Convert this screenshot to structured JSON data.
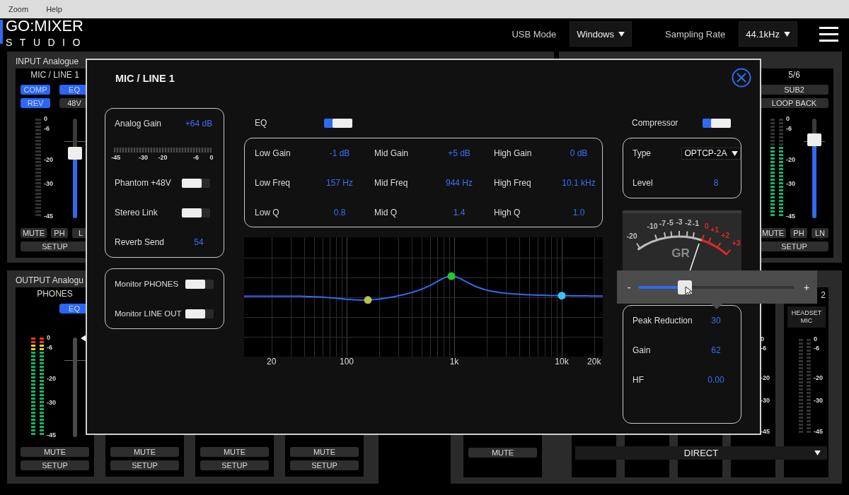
{
  "menu_bar": {
    "items": [
      "Zoom",
      "Help"
    ]
  },
  "header": {
    "logo": {
      "line_1": "GO:MIXER",
      "line_2": "STUDIO"
    },
    "usb_mode": {
      "label": "USB Mode",
      "value": "Windows"
    },
    "sampling_rate": {
      "label": "Sampling Rate",
      "value": "44.1kHz"
    }
  },
  "input_panel": {
    "title": "INPUT Analogue",
    "strips": [
      {
        "kind": "channel",
        "label": "MIC / LINE 1",
        "top_rows": [
          [
            {
              "text": "COMP",
              "on": true,
              "kind": "narrow"
            },
            {
              "text": "EQ",
              "on": true,
              "kind": "narrow"
            }
          ],
          [
            {
              "text": "REV",
              "on": true,
              "kind": "narrow"
            },
            {
              "text": "48V",
              "on": false,
              "kind": "narrow"
            }
          ]
        ],
        "meter": {
          "kind": "mono",
          "level": 0
        },
        "scale": [
          "0",
          "-6",
          "-20",
          "-30",
          "-45"
        ],
        "fader": {
          "kind": "input",
          "level": 0.65
        },
        "bottom_rows": [
          [
            {
              "text": "MUTE",
              "on": false,
              "kind": "wide"
            },
            {
              "text": "PH",
              "on": false,
              "kind": "narrow"
            },
            {
              "text": "L",
              "on": false,
              "kind": "narrow"
            }
          ],
          [
            {
              "text": "SETUP",
              "on": false,
              "kind": "wide"
            }
          ]
        ]
      }
    ]
  },
  "aux_panel": {
    "strips": [
      {
        "kind": "channel",
        "label": "5/6",
        "top_rows": [
          [
            {
              "text": "SUB2",
              "on": false,
              "kind": "wide"
            }
          ],
          [
            {
              "text": "LOOP BACK",
              "on": false,
              "kind": "wide"
            }
          ]
        ],
        "meter": {
          "kind": "stereo",
          "level": 0.71
        },
        "scale": [
          "0",
          "-6",
          "-20",
          "-30",
          "-45"
        ],
        "fader": {
          "kind": "input",
          "level": 0.79
        },
        "bottom_rows": [
          [
            {
              "text": "MUTE",
              "on": false,
              "kind": "wide"
            },
            {
              "text": "PH",
              "on": false,
              "kind": "narrow"
            },
            {
              "text": "LN",
              "on": false,
              "kind": "narrow"
            }
          ],
          [
            {
              "text": "SETUP",
              "on": false,
              "kind": "wide"
            }
          ]
        ]
      }
    ]
  },
  "output_panel": {
    "title": "OUTPUT Analogu",
    "strips": [
      {
        "kind": "channel",
        "label": "PHONES",
        "top_rows": [
          [
            {
              "text": "EQ",
              "on": true,
              "kind": "narrow"
            }
          ]
        ],
        "meter": {
          "kind": "stereo",
          "level": 1
        },
        "scale": [
          "0",
          "-6",
          "-20",
          "-30",
          "-45"
        ],
        "fader": {
          "kind": "output"
        },
        "bottom_rows": [
          [
            {
              "text": "MUTE",
              "on": false,
              "kind": "wide"
            }
          ],
          [
            {
              "text": "SETUP",
              "on": false,
              "kind": "wide"
            }
          ]
        ]
      },
      {
        "kind": "channel",
        "bottom_rows": [
          [
            {
              "text": "MUTE",
              "on": false,
              "kind": "wide"
            }
          ],
          [
            {
              "text": "SETUP",
              "on": false,
              "kind": "wide"
            }
          ]
        ]
      },
      {
        "kind": "channel",
        "bottom_rows": [
          [
            {
              "text": "MUTE",
              "on": false,
              "kind": "wide"
            }
          ],
          [
            {
              "text": "SETUP",
              "on": false,
              "kind": "wide"
            }
          ]
        ]
      },
      {
        "kind": "channel",
        "bottom_rows": [
          [
            {
              "text": "MUTE",
              "on": false,
              "kind": "wide"
            }
          ],
          [
            {
              "text": "SETUP",
              "on": false,
              "kind": "wide"
            }
          ]
        ]
      }
    ]
  },
  "return_panel": {
    "strips": [
      {
        "kind": "channel",
        "bottom_rows": [
          [
            {
              "text": "MUTE",
              "on": false,
              "kind": "wide"
            }
          ]
        ]
      },
      {
        "kind": "narrow"
      },
      {
        "kind": "narrow"
      },
      {
        "kind": "narrow"
      },
      {
        "kind": "narrow",
        "scale": [
          "0",
          "-6",
          "-20",
          "-30",
          "-45"
        ]
      },
      {
        "kind": "narrow",
        "label": "2",
        "header": "HEADSET MIC",
        "meter": {
          "kind": "stereo",
          "level": 0
        },
        "scale": [
          "0",
          "-6",
          "-20",
          "-30",
          "-45"
        ]
      }
    ],
    "route_select": "DIRECT"
  },
  "dialog": {
    "title": "MIC / LINE 1",
    "input_card": {
      "analog_gain": {
        "label": "Analog Gain",
        "value": "+64 dB"
      },
      "gain_meter": {
        "level": 0,
        "scale": [
          "-45",
          "-30",
          "-20",
          "-6",
          "0"
        ]
      },
      "toggles": [
        {
          "label": "Phantom +48V",
          "on": false
        },
        {
          "label": "Stereo Link",
          "on": false
        }
      ],
      "reverb_send": {
        "label": "Reverb Send",
        "value": "54"
      }
    },
    "monitor_card": {
      "toggles": [
        {
          "label": "Monitor PHONES",
          "on": false
        },
        {
          "label": "Monitor LINE OUT",
          "on": false
        }
      ]
    },
    "eq": {
      "label": "EQ",
      "on": true,
      "bands": [
        {
          "color": "#b8c44a",
          "params": [
            {
              "label": "Low Gain",
              "value": "-1 dB"
            },
            {
              "label": "Low Freq",
              "value": "157 Hz"
            },
            {
              "label": "Low Q",
              "value": "0.8"
            }
          ]
        },
        {
          "color": "#22c92a",
          "params": [
            {
              "label": "Mid Gain",
              "value": "+5 dB"
            },
            {
              "label": "Mid Freq",
              "value": "944 Hz"
            },
            {
              "label": "Mid Q",
              "value": "1.4"
            }
          ]
        },
        {
          "color": "#3cc3f5",
          "params": [
            {
              "label": "High Gain",
              "value": "0 dB"
            },
            {
              "label": "High Freq",
              "value": "10.1 kHz"
            },
            {
              "label": "High Q",
              "value": "1.0"
            }
          ]
        }
      ],
      "freq_labels": [
        "20",
        "100",
        "1k",
        "10k",
        "20k"
      ]
    },
    "compressor": {
      "label": "Compressor",
      "on": true,
      "type": {
        "label": "Type",
        "value": "OPTCP-2A"
      },
      "output_level": {
        "label": "Level",
        "value": "8"
      },
      "gr_meter": {
        "title": "GR",
        "scale": [
          {
            "text": "-20",
            "color": "#bdbdbd"
          },
          {
            "text": "-10",
            "color": "#bdbdbd"
          },
          {
            "text": "-7",
            "color": "#bdbdbd"
          },
          {
            "text": "-5",
            "color": "#bdbdbd"
          },
          {
            "text": "-3",
            "color": "#bdbdbd"
          },
          {
            "text": "-2",
            "color": "#bdbdbd"
          },
          {
            "text": "-1",
            "color": "#bdbdbd"
          },
          {
            "text": "0",
            "color": "#e0262a"
          },
          {
            "text": "+1",
            "color": "#e0262a"
          },
          {
            "text": "+2",
            "color": "#e0262a"
          },
          {
            "text": "+3",
            "color": "#e0262a"
          }
        ]
      },
      "params": [
        {
          "label": "Peak Reduction",
          "value": "30"
        },
        {
          "label": "Gain",
          "value": "62"
        },
        {
          "label": "HF",
          "value": "0.00"
        }
      ]
    }
  },
  "slider_popup": {
    "minus": "-",
    "plus": "+",
    "level": 0.3
  }
}
